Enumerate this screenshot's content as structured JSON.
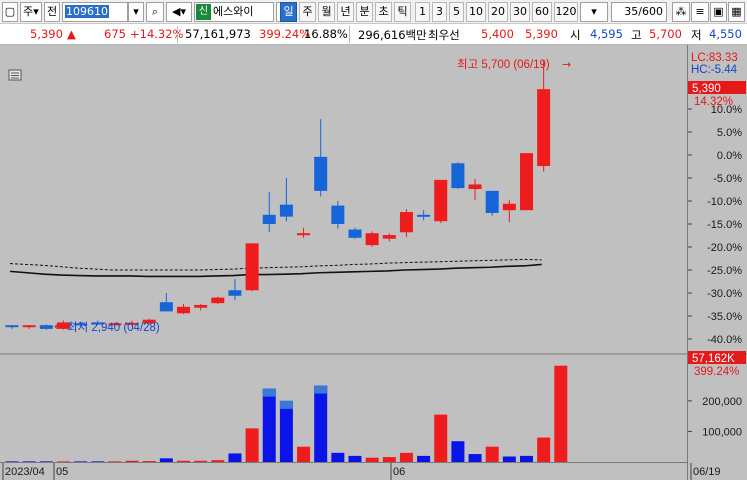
{
  "toolbar": {
    "market": "주",
    "prev": "전",
    "code": "109610",
    "badge": "신",
    "name": "에스와이",
    "periods": [
      "일",
      "주",
      "월",
      "년",
      "분",
      "초",
      "틱"
    ],
    "minutes": [
      "1",
      "3",
      "5",
      "10",
      "20",
      "30",
      "60",
      "120"
    ],
    "count": "35/600"
  },
  "info": {
    "price": "5,390",
    "arrow": "▲",
    "change": "675",
    "change_pct": "+14.32%",
    "volume": "57,161,973",
    "volume_ratio": "399.24%",
    "turnover": "16.88%",
    "market_cap": "296,616백만",
    "best_ask_label": "최우선",
    "best_ask": "5,400",
    "best_bid": "5,390",
    "open_label": "시",
    "open": "4,595",
    "high_label": "고",
    "high": "5,700",
    "low_label": "저",
    "low": "4,550"
  },
  "annotations": {
    "high_label": "최고 5,700 (06/19)",
    "low_label": "최저 2,940 (04/28)",
    "lc": "LC:83.33",
    "hc": "HC:-5.44",
    "last_price": "5,390",
    "last_pct": "14.32%",
    "last_volume": "57,162K",
    "last_volume_pct": "399.24%"
  },
  "colors": {
    "up": "#ee1c1c",
    "down": "#1565d8",
    "vol_up": "#ee1c1c",
    "vol_down": "#0a14e8",
    "background": "#c0c0c0"
  },
  "chart_data": {
    "type": "candlestick",
    "y_axis_ticks": [
      "10.0%",
      "5.0%",
      "0.0%",
      "-5.0%",
      "-10.0%",
      "-15.0%",
      "-20.0%",
      "-25.0%",
      "-30.0%",
      "-35.0%",
      "-40.0%"
    ],
    "x_axis_labels": [
      "2023/04",
      "05",
      "06",
      "06/19"
    ],
    "volume_ticks": [
      "200,000",
      "100,000"
    ],
    "candles": [
      {
        "o": -37.4,
        "h": -37.0,
        "l": -37.8,
        "c": -37.0,
        "up": false
      },
      {
        "o": -37.4,
        "h": -37.0,
        "l": -37.8,
        "c": -37.0,
        "up": true
      },
      {
        "o": -37.0,
        "h": -36.8,
        "l": -38.0,
        "c": -37.8,
        "up": false
      },
      {
        "o": -37.8,
        "h": -36.0,
        "l": -38.0,
        "c": -36.4,
        "up": true
      },
      {
        "o": -36.6,
        "h": -36.2,
        "l": -37.2,
        "c": -36.6,
        "up": false
      },
      {
        "o": -36.6,
        "h": -36.0,
        "l": -37.0,
        "c": -36.4,
        "up": false
      },
      {
        "o": -36.6,
        "h": -36.4,
        "l": -37.0,
        "c": -36.6,
        "up": true
      },
      {
        "o": -36.5,
        "h": -36.0,
        "l": -37.2,
        "c": -36.8,
        "up": true
      },
      {
        "o": -36.6,
        "h": -35.6,
        "l": -36.8,
        "c": -35.8,
        "up": true
      },
      {
        "o": -32.0,
        "h": -30.0,
        "l": -34.0,
        "c": -34.0,
        "up": false
      },
      {
        "o": -34.4,
        "h": -32.4,
        "l": -34.6,
        "c": -33.0,
        "up": true
      },
      {
        "o": -33.2,
        "h": -32.4,
        "l": -33.8,
        "c": -32.6,
        "up": true
      },
      {
        "o": -32.2,
        "h": -30.8,
        "l": -32.4,
        "c": -31.0,
        "up": true
      },
      {
        "o": -29.4,
        "h": -27.0,
        "l": -31.6,
        "c": -30.6,
        "up": false
      },
      {
        "o": -29.4,
        "h": -20.8,
        "l": -29.6,
        "c": -19.2,
        "up": true
      },
      {
        "o": -13.0,
        "h": -8.0,
        "l": -16.8,
        "c": -15.0,
        "up": false
      },
      {
        "o": -10.8,
        "h": -5.0,
        "l": -14.4,
        "c": -13.4,
        "up": false
      },
      {
        "o": -17.0,
        "h": -15.8,
        "l": -18.0,
        "c": -17.0,
        "up": true
      },
      {
        "o": -0.4,
        "h": 7.8,
        "l": -9.0,
        "c": -7.8,
        "up": false
      },
      {
        "o": -11.0,
        "h": -10.0,
        "l": -16.0,
        "c": -15.0,
        "up": false
      },
      {
        "o": -16.2,
        "h": -15.8,
        "l": -18.2,
        "c": -18.0,
        "up": false
      },
      {
        "o": -17.0,
        "h": -16.6,
        "l": -20.0,
        "c": -19.6,
        "up": true
      },
      {
        "o": -18.2,
        "h": -17.0,
        "l": -18.8,
        "c": -17.4,
        "up": true
      },
      {
        "o": -16.8,
        "h": -11.8,
        "l": -17.8,
        "c": -12.4,
        "up": true
      },
      {
        "o": -13.0,
        "h": -12.0,
        "l": -14.2,
        "c": -13.0,
        "up": false
      },
      {
        "o": -14.4,
        "h": -5.8,
        "l": -14.8,
        "c": -5.4,
        "up": true
      },
      {
        "o": -1.8,
        "h": -1.6,
        "l": -7.4,
        "c": -7.2,
        "up": false
      },
      {
        "o": -7.4,
        "h": -5.2,
        "l": -9.8,
        "c": -6.4,
        "up": true
      },
      {
        "o": -7.8,
        "h": -7.8,
        "l": -13.2,
        "c": -12.6,
        "up": false
      },
      {
        "o": -12.0,
        "h": -9.8,
        "l": -14.6,
        "c": -10.6,
        "up": true
      },
      {
        "o": -12.0,
        "h": 0.4,
        "l": -12.0,
        "c": 0.4,
        "up": true
      },
      {
        "o": -2.4,
        "h": 20.6,
        "l": -3.6,
        "c": 14.3,
        "up": true
      }
    ],
    "volumes": [
      {
        "v": 2,
        "up": false
      },
      {
        "v": 2,
        "up": false
      },
      {
        "v": 2,
        "up": false
      },
      {
        "v": 2,
        "up": true
      },
      {
        "v": 2,
        "up": false
      },
      {
        "v": 2,
        "up": false
      },
      {
        "v": 2,
        "up": true
      },
      {
        "v": 4,
        "up": true
      },
      {
        "v": 3,
        "up": true
      },
      {
        "v": 12,
        "up": false
      },
      {
        "v": 4,
        "up": true
      },
      {
        "v": 4,
        "up": true
      },
      {
        "v": 6,
        "up": true
      },
      {
        "v": 28,
        "up": false
      },
      {
        "v": 110,
        "up": true
      },
      {
        "v": 240,
        "up": false
      },
      {
        "v": 200,
        "up": false
      },
      {
        "v": 50,
        "up": true
      },
      {
        "v": 250,
        "up": false
      },
      {
        "v": 30,
        "up": false
      },
      {
        "v": 20,
        "up": false
      },
      {
        "v": 14,
        "up": true
      },
      {
        "v": 16,
        "up": true
      },
      {
        "v": 30,
        "up": true
      },
      {
        "v": 20,
        "up": false
      },
      {
        "v": 155,
        "up": true
      },
      {
        "v": 68,
        "up": false
      },
      {
        "v": 26,
        "up": false
      },
      {
        "v": 50,
        "up": true
      },
      {
        "v": 18,
        "up": false
      },
      {
        "v": 20,
        "up": false
      },
      {
        "v": 80,
        "up": true
      },
      {
        "v": 315,
        "up": true
      }
    ],
    "volume_max": 350,
    "ma_solid": [
      -25.3,
      -25.6,
      -25.9,
      -26.1,
      -26.2,
      -26.3,
      -26.3,
      -26.3,
      -26.4,
      -26.4,
      -26.4,
      -26.4,
      -26.3,
      -26.2,
      -26.0,
      -26.0,
      -25.9,
      -25.8,
      -25.6,
      -25.5,
      -25.4,
      -25.3,
      -25.2,
      -25.0,
      -24.9,
      -24.8,
      -24.6,
      -24.5,
      -24.4,
      -24.2,
      -24.1,
      -23.8
    ],
    "ma_dashed": [
      -23.6,
      -23.8,
      -24.0,
      -24.3,
      -24.6,
      -24.8,
      -25.0,
      -25.0,
      -25.0,
      -25.0,
      -25.0,
      -25.0,
      -24.9,
      -24.8,
      -24.6,
      -24.5,
      -24.4,
      -24.3,
      -24.1,
      -24.0,
      -23.8,
      -23.7,
      -23.5,
      -23.4,
      -23.3,
      -23.2,
      -23.1,
      -23.0,
      -22.9,
      -22.8,
      -22.7,
      -22.8
    ]
  }
}
